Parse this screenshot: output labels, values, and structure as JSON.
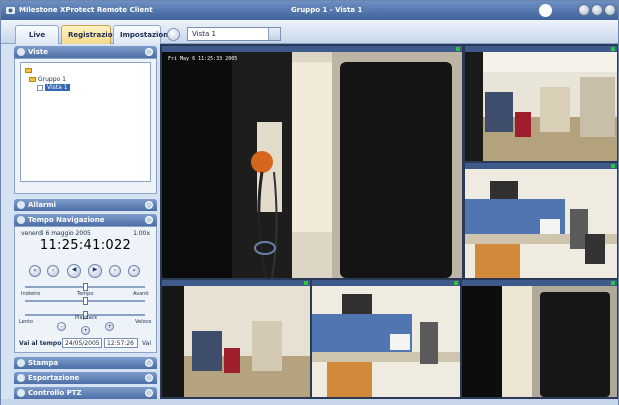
{
  "window": {
    "app_title": "Milestone XProtect Remote Client",
    "view_title": "Gruppo 1 - Vista 1"
  },
  "tabs": [
    {
      "label": "Live"
    },
    {
      "label": "Registrazioni",
      "active": true
    },
    {
      "label": "Impostazioni"
    }
  ],
  "view_selector": {
    "value": "Vista 1"
  },
  "panels": {
    "viste": {
      "title": "Viste",
      "tree": {
        "group": "Gruppo 1",
        "view": "Vista 1"
      }
    },
    "allarmi": {
      "title": "Allarmi"
    },
    "tempo": {
      "title": "Tempo Navigazione",
      "date": "venerdì 6 maggio 2005",
      "speed": "1.00x",
      "clock": "11:25:41:022",
      "labels": {
        "indietro": "Indietro",
        "tempo": "Tempo",
        "avanti": "Avanti",
        "lento": "Lento",
        "playback": "Playback",
        "veloce": "Veloce"
      },
      "goto_label": "Vai al tempo:",
      "goto_date": "24/05/2005",
      "goto_time": "12:57:26",
      "goto_button": "Vai"
    },
    "stampa": {
      "title": "Stampa"
    },
    "esportazione": {
      "title": "Esportazione"
    },
    "ptz": {
      "title": "Controllo PTZ"
    }
  },
  "cameras": [
    {
      "timestamp": "Fri May 6 11:25:33 2005"
    }
  ],
  "colors": {
    "title_bar": "#4f72ab",
    "panel_header": "#5c7db2",
    "active_tab": "#f4d98a",
    "panel_bg": "#eef3fa"
  }
}
